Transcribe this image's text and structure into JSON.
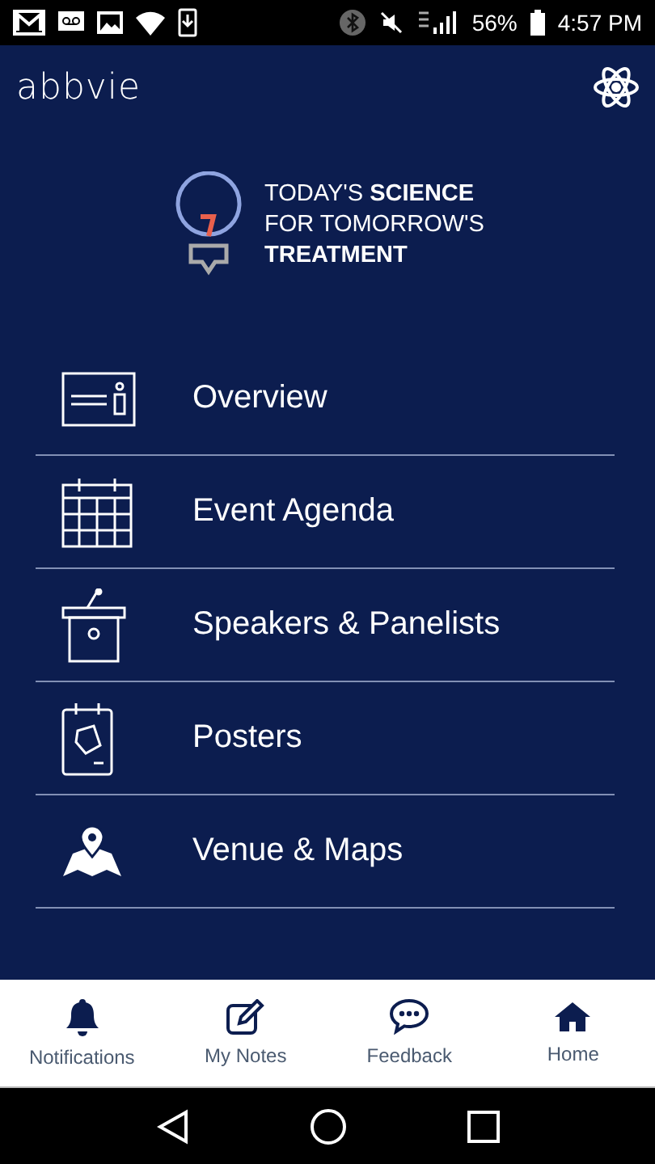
{
  "status_bar": {
    "battery": "56%",
    "time": "4:57 PM"
  },
  "header": {
    "logo": "abbvie"
  },
  "tagline": [
    "TODAY'S **SCIENCE**",
    "FOR TOMORROW'S",
    "**TREATMENT**"
  ],
  "menu": [
    {
      "kind": "overview",
      "label": "Overview"
    },
    {
      "kind": "agenda",
      "label": "Event Agenda"
    },
    {
      "kind": "speakers",
      "label": "Speakers & Panelists"
    },
    {
      "kind": "posters",
      "label": "Posters"
    },
    {
      "kind": "venue",
      "label": "Venue & Maps"
    }
  ],
  "tab_bar": [
    {
      "kind": "notifications",
      "label": "Notifications"
    },
    {
      "kind": "notes",
      "label": "My Notes"
    },
    {
      "kind": "feedback",
      "label": "Feedback"
    },
    {
      "kind": "home",
      "label": "Home"
    }
  ]
}
